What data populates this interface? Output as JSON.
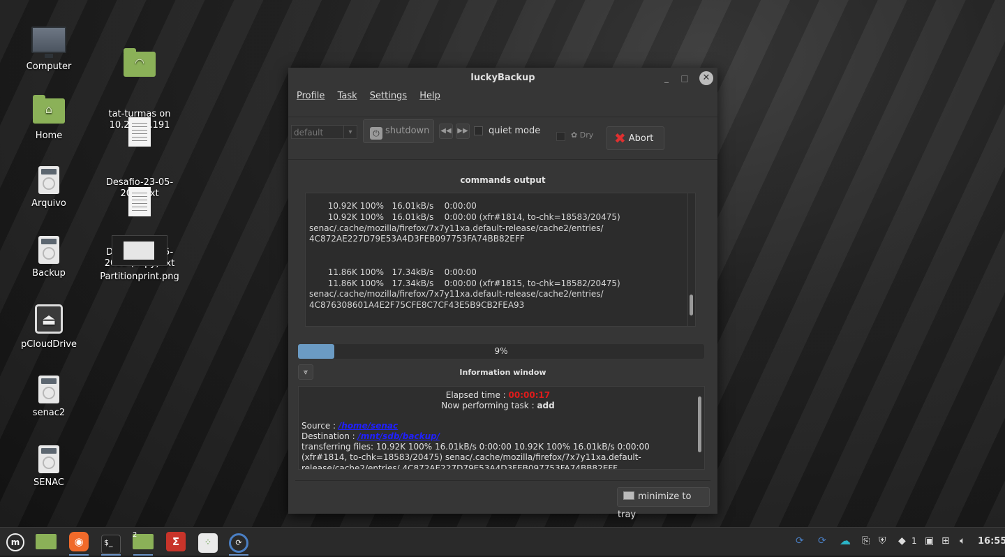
{
  "desktop": {
    "icons": [
      {
        "label": "Computer",
        "icon": "computer-icon"
      },
      {
        "label": "Home",
        "icon": "home-folder-icon"
      },
      {
        "label": "Arquivo",
        "icon": "drive-icon"
      },
      {
        "label": "Backup",
        "icon": "drive-icon"
      },
      {
        "label": "pCloudDrive",
        "icon": "eject-drive-icon"
      },
      {
        "label": "senac2",
        "icon": "drive-icon"
      },
      {
        "label": "SENAC",
        "icon": "drive-icon"
      },
      {
        "label": "tat-turmas on\n10.26.40.191",
        "icon": "network-folder-icon"
      },
      {
        "label": "Desafio-23-05-\n2022.txt",
        "icon": "text-file-icon"
      },
      {
        "label": "Desafio-23-05-\n2022 (copy).txt",
        "icon": "text-file-icon"
      },
      {
        "label": "Partitionprint.png",
        "icon": "image-file-icon"
      }
    ]
  },
  "window": {
    "title": "luckyBackup",
    "menu": [
      "Profile",
      "Task",
      "Settings",
      "Help"
    ],
    "toolbar": {
      "profile_value": "default",
      "shutdown_label": "shutdown",
      "quiet_mode_label": "quiet mode",
      "dry_label": "Dry",
      "abort_label": "Abort"
    },
    "commands_output_title": "commands output",
    "output_lines": [
      "       10.92K 100%   16.01kB/s    0:00:00",
      "       10.92K 100%   16.01kB/s    0:00:00 (xfr#1814, to-chk=18583/20475)",
      "senac/.cache/mozilla/firefox/7x7y11xa.default-release/cache2/entries/",
      "4C872AE227D79E53A4D3FEB097753FA74BB82EFF",
      "",
      "",
      "       11.86K 100%   17.34kB/s    0:00:00",
      "       11.86K 100%   17.34kB/s    0:00:00 (xfr#1815, to-chk=18582/20475)",
      "senac/.cache/mozilla/firefox/7x7y11xa.default-release/cache2/entries/",
      "4C876308601A4E2F75CFE8C7CF43E5B9CB2FEA93"
    ],
    "progress": {
      "value": 0.09,
      "label": "9%"
    },
    "information_title": "Information window",
    "info": {
      "elapsed_label": "Elapsed time : ",
      "elapsed_value": "00:00:17",
      "task_label": "Now performing task : ",
      "task_value": "add",
      "source_label": "Source : ",
      "source_value": "/home/senac",
      "destination_label": "Destination : ",
      "destination_value": "/mnt/sdb/backup/",
      "transfer_text": "transferring files: 10.92K 100% 16.01kB/s 0:00:00 10.92K 100% 16.01kB/s 0:00:00 (xfr#1814, to-chk=18583/20475) senac/.cache/mozilla/firefox/7x7y11xa.default-release/cache2/entries/ 4C872AE227D79E53A4D3FEB097753FA74BB82EFF"
    },
    "minimize_label": "minimize to tray"
  },
  "taskbar": {
    "apps": [
      "mint-menu-icon",
      "files-icon",
      "firefox-icon",
      "terminal-icon",
      "files-icon",
      "fontforge-icon",
      "apps-grid-icon",
      "luckybackup-icon"
    ],
    "files_badge": "2",
    "workspace_count": "1",
    "clock": "16:55"
  }
}
